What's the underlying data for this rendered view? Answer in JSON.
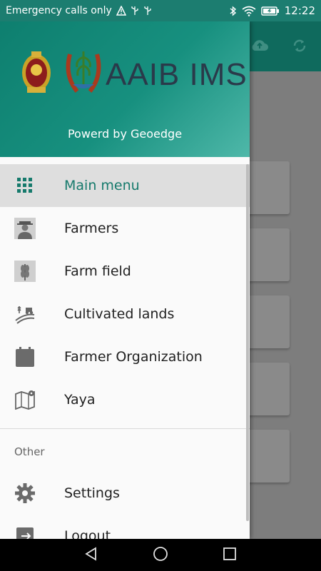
{
  "status_bar": {
    "carrier": "Emergency calls only",
    "time": "12:22",
    "icons": [
      "warning-icon",
      "usb-icon",
      "usb-icon",
      "bluetooth-icon",
      "wifi-alert-icon",
      "battery-charging-icon"
    ]
  },
  "app_toolbar": {
    "icons": [
      "cloud-upload-icon",
      "sync-icon"
    ]
  },
  "drawer": {
    "brand": "AAIB IMS",
    "powered_by": "Powerd by Geoedge",
    "menu": [
      {
        "label": "Main menu",
        "icon": "grid-icon",
        "active": true
      },
      {
        "label": "Farmers",
        "icon": "farmer-icon",
        "active": false
      },
      {
        "label": "Farm field",
        "icon": "crop-icon",
        "active": false
      },
      {
        "label": "Cultivated lands",
        "icon": "field-icon",
        "active": false
      },
      {
        "label": "Farmer Organization",
        "icon": "calendar-icon",
        "active": false
      },
      {
        "label": "Yaya",
        "icon": "map-icon",
        "active": false
      }
    ],
    "section_title": "Other",
    "other": [
      {
        "label": "Settings",
        "icon": "gear-icon"
      },
      {
        "label": "Logout",
        "icon": "logout-icon"
      }
    ]
  },
  "colors": {
    "accent": "#167a6c",
    "header_start": "#0e7f6f",
    "header_end": "#4fb8a9",
    "toolbar": "#0f6a5d"
  },
  "nav_bar": [
    "back-icon",
    "home-icon",
    "recents-icon"
  ]
}
